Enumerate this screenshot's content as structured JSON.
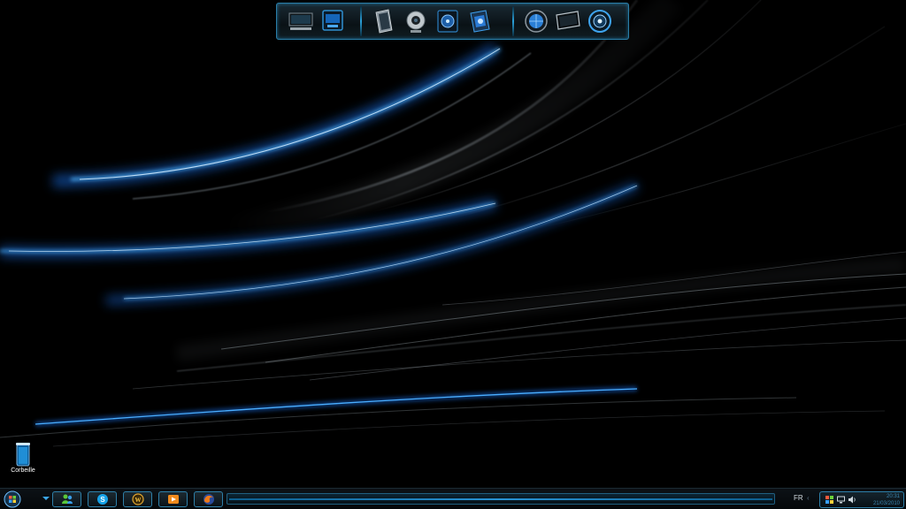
{
  "dock": {
    "group1": [
      "computer-icon",
      "network-display-icon"
    ],
    "group2": [
      "documents-icon",
      "webcam-icon",
      "music-folder-icon",
      "games-folder-icon"
    ],
    "group3": [
      "globe-icon",
      "monitor-icon",
      "settings-dial-icon"
    ],
    "accent": "#2a9fd8"
  },
  "desktop_icons": [
    {
      "label": "Corbeille",
      "icon": "recycle-bin-icon"
    }
  ],
  "taskbar": {
    "pinned": [
      "messenger-icon",
      "skype-icon",
      "world-of-warcraft-icon",
      "media-player-icon",
      "firefox-icon"
    ],
    "language": "FR",
    "tray_icons": [
      "flag-icon",
      "network-icon",
      "volume-icon"
    ],
    "clock": {
      "time": "20:31",
      "date": "21/03/2010"
    },
    "accent": "#2e7fa8"
  }
}
